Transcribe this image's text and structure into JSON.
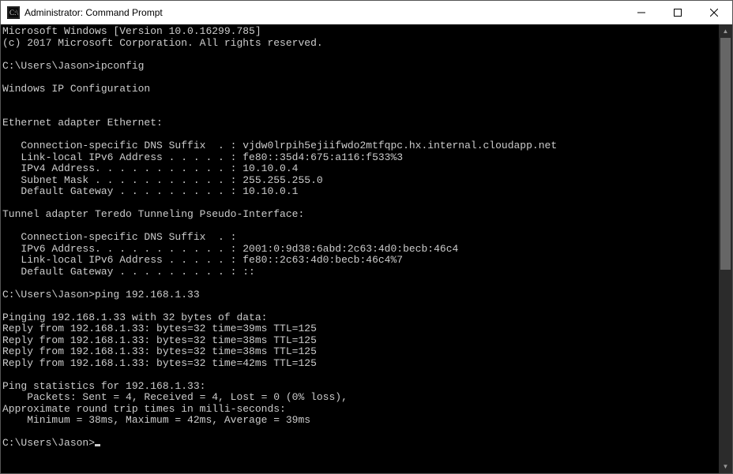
{
  "titlebar": {
    "title": "Administrator: Command Prompt"
  },
  "terminal": {
    "header1": "Microsoft Windows [Version 10.0.16299.785]",
    "header2": "(c) 2017 Microsoft Corporation. All rights reserved.",
    "blank": "",
    "prompt1": "C:\\Users\\Jason>ipconfig",
    "ipcfg_title": "Windows IP Configuration",
    "eth_header": "Ethernet adapter Ethernet:",
    "eth_dns": "   Connection-specific DNS Suffix  . : vjdw0lrpih5ejiifwdo2mtfqpc.hx.internal.cloudapp.net",
    "eth_ll": "   Link-local IPv6 Address . . . . . : fe80::35d4:675:a116:f533%3",
    "eth_ipv4": "   IPv4 Address. . . . . . . . . . . : 10.10.0.4",
    "eth_mask": "   Subnet Mask . . . . . . . . . . . : 255.255.255.0",
    "eth_gw": "   Default Gateway . . . . . . . . . : 10.10.0.1",
    "tun_header": "Tunnel adapter Teredo Tunneling Pseudo-Interface:",
    "tun_dns": "   Connection-specific DNS Suffix  . :",
    "tun_ipv6": "   IPv6 Address. . . . . . . . . . . : 2001:0:9d38:6abd:2c63:4d0:becb:46c4",
    "tun_ll": "   Link-local IPv6 Address . . . . . : fe80::2c63:4d0:becb:46c4%7",
    "tun_gw": "   Default Gateway . . . . . . . . . : ::",
    "prompt2": "C:\\Users\\Jason>ping 192.168.1.33",
    "ping_start": "Pinging 192.168.1.33 with 32 bytes of data:",
    "ping_r1": "Reply from 192.168.1.33: bytes=32 time=39ms TTL=125",
    "ping_r2": "Reply from 192.168.1.33: bytes=32 time=38ms TTL=125",
    "ping_r3": "Reply from 192.168.1.33: bytes=32 time=38ms TTL=125",
    "ping_r4": "Reply from 192.168.1.33: bytes=32 time=42ms TTL=125",
    "ping_stats_hdr": "Ping statistics for 192.168.1.33:",
    "ping_stats_pkts": "    Packets: Sent = 4, Received = 4, Lost = 0 (0% loss),",
    "ping_rtt_hdr": "Approximate round trip times in milli-seconds:",
    "ping_rtt": "    Minimum = 38ms, Maximum = 42ms, Average = 39ms",
    "prompt3": "C:\\Users\\Jason>"
  }
}
